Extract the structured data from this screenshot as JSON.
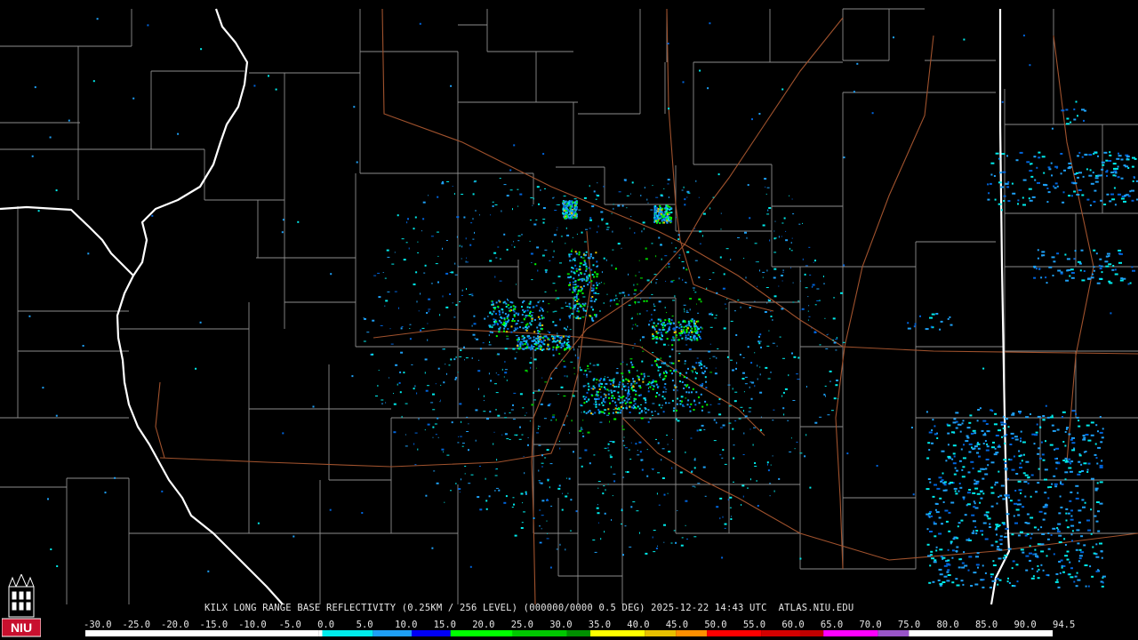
{
  "product_title": "KILX LONG RANGE BASE REFLECTIVITY (0.25KM / 256 LEVEL) (000000/0000 0.5 DEG) 2025-12-22 14:43 UTC  ATLAS.NIU.EDU",
  "logo_text": "NIU",
  "colors": {
    "background": "#000000",
    "county_lines": "#8c8c8c",
    "state_lines": "#ffffff",
    "roads": "#a0522d",
    "text": "#e6e6e6",
    "logo_red": "#c8102e"
  },
  "color_scale": {
    "labels": [
      "-30.0",
      "-25.0",
      "-20.0",
      "-15.0",
      "-10.0",
      "-5.0",
      "0.0",
      "5.0",
      "10.0",
      "15.0",
      "20.0",
      "25.0",
      "30.0",
      "35.0",
      "40.0",
      "45.0",
      "50.0",
      "55.0",
      "60.0",
      "65.0",
      "70.0",
      "75.0",
      "80.0",
      "85.0",
      "90.0",
      "94.5"
    ],
    "stops": [
      {
        "value": -30,
        "color": "#ffffff"
      },
      {
        "value": 0,
        "color": "#ffffff"
      },
      {
        "value": 0.5,
        "color": "#00ecec"
      },
      {
        "value": 7,
        "color": "#1ea0f6"
      },
      {
        "value": 12,
        "color": "#0000f6"
      },
      {
        "value": 17,
        "color": "#00ff00"
      },
      {
        "value": 25,
        "color": "#00c800"
      },
      {
        "value": 32,
        "color": "#009000"
      },
      {
        "value": 35,
        "color": "#ffff00"
      },
      {
        "value": 42,
        "color": "#e7c000"
      },
      {
        "value": 46,
        "color": "#ff9000"
      },
      {
        "value": 50,
        "color": "#ff0000"
      },
      {
        "value": 57,
        "color": "#d40000"
      },
      {
        "value": 62,
        "color": "#c00000"
      },
      {
        "value": 65,
        "color": "#ff00ff"
      },
      {
        "value": 72,
        "color": "#9955c9"
      },
      {
        "value": 76,
        "color": "#ffffff"
      },
      {
        "value": 94.5,
        "color": "#ffffff"
      }
    ]
  },
  "radar_site": "KILX"
}
